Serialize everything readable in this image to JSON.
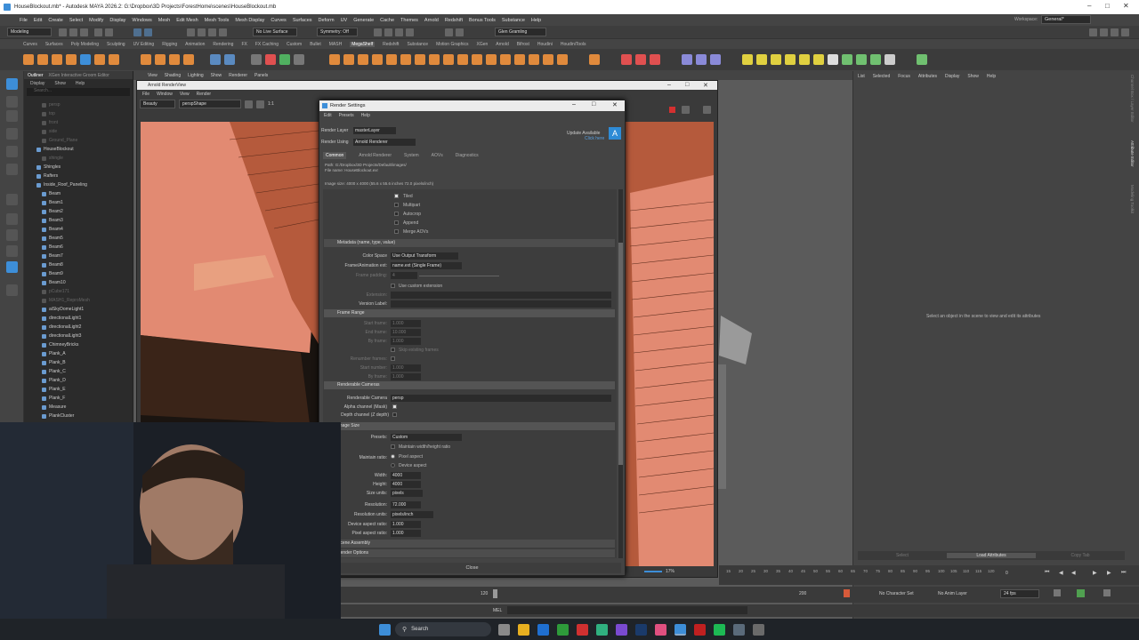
{
  "window_title": "HouseBlockout.mb* - Autodesk MAYA 2026.2: G:\\Dropbox\\3D Projects\\ForestHome\\scenes\\HouseBlockout.mb",
  "main_menu": [
    "File",
    "Edit",
    "Create",
    "Select",
    "Modify",
    "Display",
    "Windows",
    "Mesh",
    "Edit Mesh",
    "Mesh Tools",
    "Mesh Display",
    "Curves",
    "Surfaces",
    "Deform",
    "UV",
    "Generate",
    "Cache",
    "Themes",
    "Arnold",
    "Redshift",
    "Bonus Tools",
    "Substance",
    "Help"
  ],
  "workspace_label": "Workspace:",
  "workspace_value": "General*",
  "status_line": {
    "mode": "Modeling",
    "live_surface": "No Live Surface",
    "symmetry": "Symmetry: Off",
    "user": "Glen Gramling"
  },
  "shelf_tabs": [
    "Curves",
    "Surfaces",
    "Poly Modeling",
    "Sculpting",
    "UV Editing",
    "Rigging",
    "Animation",
    "Rendering",
    "FX",
    "FX Caching",
    "Custom",
    "Bullet",
    "MASH",
    "MegaShelf",
    "Redshift",
    "Substance",
    "Motion Graphics",
    "XGen",
    "Arnold",
    "Bifrost",
    "Houdini",
    "HoudiniTools"
  ],
  "shelf_active": "MegaShelf",
  "outliner": {
    "tabs": [
      "Outliner",
      "XGen Interactive Groom Editor"
    ],
    "menu": [
      "Display",
      "Show",
      "Help"
    ],
    "search_placeholder": "Search...",
    "items": [
      {
        "name": "persp",
        "dim": true
      },
      {
        "name": "top",
        "dim": true
      },
      {
        "name": "front",
        "dim": true
      },
      {
        "name": "side",
        "dim": true
      },
      {
        "name": "Ground_Plane",
        "dim": true
      },
      {
        "name": "HouseBlockout",
        "dim": false
      },
      {
        "name": "shingle",
        "dim": true
      },
      {
        "name": "Shingles",
        "dim": false
      },
      {
        "name": "Rafters",
        "dim": false
      },
      {
        "name": "Inside_Roof_Paneling",
        "dim": false
      },
      {
        "name": "Beam",
        "dim": false
      },
      {
        "name": "Beam1",
        "dim": false
      },
      {
        "name": "Beam2",
        "dim": false
      },
      {
        "name": "Beam3",
        "dim": false
      },
      {
        "name": "Beam4",
        "dim": false
      },
      {
        "name": "Beam5",
        "dim": false
      },
      {
        "name": "Beam6",
        "dim": false
      },
      {
        "name": "Beam7",
        "dim": false
      },
      {
        "name": "Beam8",
        "dim": false
      },
      {
        "name": "Beam9",
        "dim": false
      },
      {
        "name": "Beam10",
        "dim": false
      },
      {
        "name": "pCube171",
        "dim": true
      },
      {
        "name": "MASH1_ReproMesh",
        "dim": true
      },
      {
        "name": "aiSkyDomeLight1",
        "dim": false
      },
      {
        "name": "directionalLight1",
        "dim": false
      },
      {
        "name": "directionalLight2",
        "dim": false
      },
      {
        "name": "directionalLight3",
        "dim": false
      },
      {
        "name": "ChimneyBricks",
        "dim": false
      },
      {
        "name": "Plank_A",
        "dim": false
      },
      {
        "name": "Plank_B",
        "dim": false
      },
      {
        "name": "Plank_C",
        "dim": false
      },
      {
        "name": "Plank_D",
        "dim": false
      },
      {
        "name": "Plank_E",
        "dim": false
      },
      {
        "name": "Plank_F",
        "dim": false
      },
      {
        "name": "Measure",
        "dim": false
      },
      {
        "name": "PlankCluster",
        "dim": false
      }
    ]
  },
  "viewport_menu": [
    "View",
    "Shading",
    "Lighting",
    "Show",
    "Renderer",
    "Panels"
  ],
  "render_view": {
    "title": "Arnold RenderView",
    "menu": [
      "File",
      "Window",
      "View",
      "Render"
    ],
    "aov": "Beauty",
    "camera": "perspShape",
    "ratio": "1:1",
    "zoom": "17%"
  },
  "render_settings": {
    "title": "Render Settings",
    "menu": [
      "Edit",
      "Presets",
      "Help"
    ],
    "render_layer_label": "Render Layer",
    "render_layer": "masterLayer",
    "render_using_label": "Render Using",
    "render_using": "Arnold Renderer",
    "update_label": "Update Available",
    "update_link": "Click here",
    "tabs": [
      "Common",
      "Arnold Renderer",
      "System",
      "AOVs",
      "Diagnostics"
    ],
    "path": "Path: G:/Dropbox/3D Projects/Default/images/",
    "file_name": "File name: HouseBlockout.exr",
    "image_size_info": "Image size: 4000 x 4000 (55.6 x 55.6 inches 72.0 pixels/inch)",
    "checks": [
      {
        "label": "Tiled",
        "checked": true
      },
      {
        "label": "Multipart",
        "checked": false
      },
      {
        "label": "Autocrop",
        "checked": false
      },
      {
        "label": "Append",
        "checked": false
      },
      {
        "label": "Merge AOVs",
        "checked": false
      }
    ],
    "metadata_header": "Metadata (name, type, value)",
    "color_space_label": "Color Space",
    "color_space": "Use Output Transform",
    "frame_ext_label": "Frame/Animation ext:",
    "frame_ext": "name.ext (Single Frame)",
    "frame_padding_label": "Frame padding:",
    "frame_padding": "4",
    "custom_ext_label": "Use custom extension",
    "extension_label": "Extension:",
    "version_label": "Version Label:",
    "frame_range_header": "Frame Range",
    "start_frame_label": "Start frame:",
    "start_frame": "1.000",
    "end_frame_label": "End frame:",
    "end_frame": "10.000",
    "by_frame_label": "By frame:",
    "by_frame": "1.000",
    "skip_frames_label": "Skip existing frames",
    "renumber_label": "Renumber frames:",
    "start_number_label": "Start number:",
    "start_number": "1.000",
    "by_frame2": "1.000",
    "renderable_cameras_header": "Renderable Cameras",
    "renderable_camera_label": "Renderable Camera",
    "renderable_camera": "persp",
    "alpha_label": "Alpha channel (Mask)",
    "depth_label": "Depth channel (Z depth)",
    "image_size_header": "Image Size",
    "presets_label": "Presets:",
    "presets": "Custom",
    "maintain_wh_label": "Maintain width/height ratio",
    "maintain_ratio_label": "Maintain ratio:",
    "pixel_aspect_label": "Pixel aspect",
    "device_aspect_label": "Device aspect",
    "width_label": "Width:",
    "width": "4000",
    "height_label": "Height:",
    "height": "4000",
    "size_units_label": "Size units:",
    "size_units": "pixels",
    "resolution_label": "Resolution:",
    "resolution": "72.000",
    "resolution_units_label": "Resolution units:",
    "resolution_units": "pixels/inch",
    "device_ratio_label": "Device aspect ratio:",
    "device_ratio": "1.000",
    "pixel_ratio_label": "Pixel aspect ratio:",
    "pixel_ratio": "1.000",
    "scene_assembly_header": "Scene Assembly",
    "render_options_header": "Render Options",
    "close_label": "Close"
  },
  "attribute_editor": {
    "menu": [
      "List",
      "Selected",
      "Focus",
      "Attributes",
      "Display",
      "Show",
      "Help"
    ],
    "empty_message": "Select an object in the scene to view and edit its attributes",
    "select_label": "Select",
    "load_label": "Load Attributes",
    "copy_label": "Copy Tab",
    "side_tabs": [
      "Channel Box / Layer Editor",
      "Attribute Editor",
      "Modeling Toolkit"
    ]
  },
  "timeline": {
    "ticks": [
      "15",
      "20",
      "25",
      "30",
      "35",
      "40",
      "45",
      "50",
      "55",
      "60",
      "65",
      "70",
      "75",
      "80",
      "85",
      "90",
      "95",
      "100",
      "105",
      "110",
      "115",
      "120"
    ],
    "current_frame": "0",
    "range_start": "120",
    "range_end": "200",
    "character_set": "No Character Set",
    "anim_layer": "No Anim Layer",
    "fps": "24 fps"
  },
  "command_line_label": "MEL",
  "taskbar": {
    "search_placeholder": "Search"
  },
  "colors": {
    "maya_blue": "#3d8ed8",
    "roof_salmon": "#e28a72",
    "shingle_dark": "#b55a3c",
    "update_blue": "#2e8bd6"
  }
}
